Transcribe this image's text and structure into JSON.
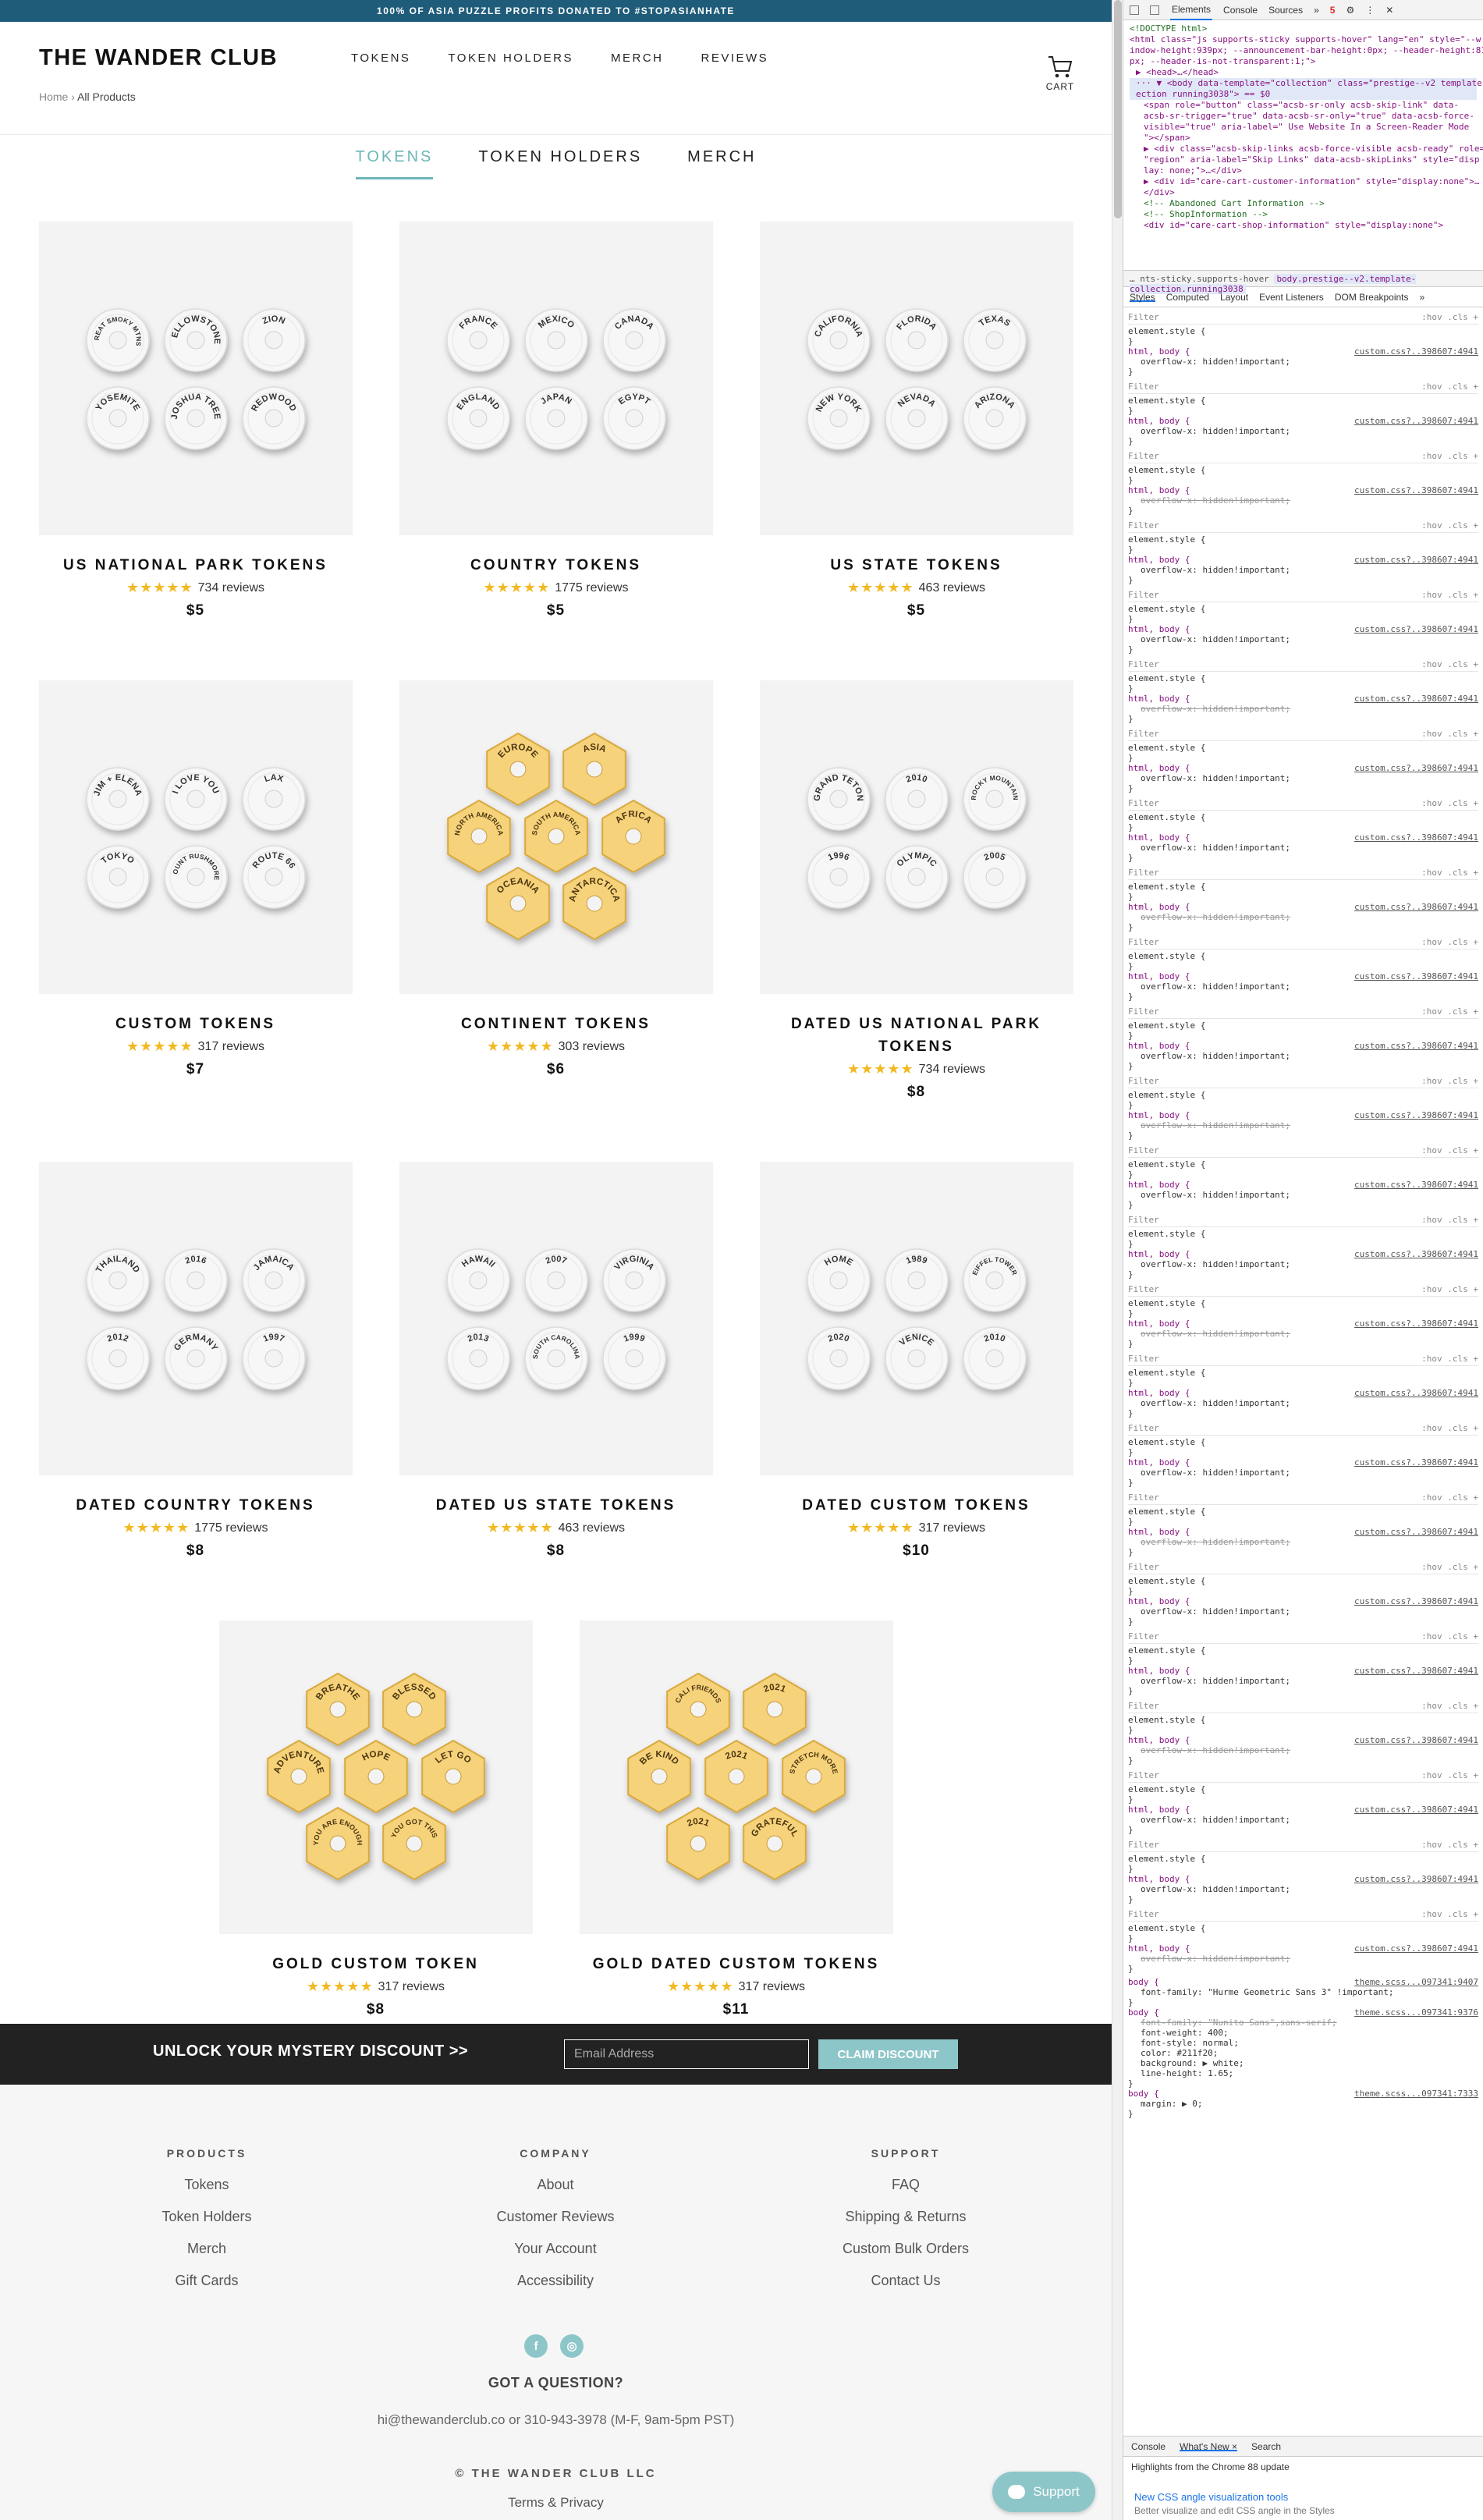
{
  "announcement": "100% OF ASIA PUZZLE PROFITS DONATED TO #STOPASIANHATE",
  "logo": "THE WANDER CLUB",
  "main_nav": [
    "TOKENS",
    "TOKEN HOLDERS",
    "MERCH",
    "REVIEWS"
  ],
  "cart_label": "CART",
  "breadcrumb": {
    "home": "Home",
    "separator": "›",
    "current": "All Products"
  },
  "collection_tabs": [
    {
      "label": "TOKENS",
      "active": true
    },
    {
      "label": "TOKEN HOLDERS",
      "active": false
    },
    {
      "label": "MERCH",
      "active": false
    }
  ],
  "products": [
    {
      "title": "US NATIONAL PARK TOKENS",
      "stars": "★★★★★",
      "reviews": "734 reviews",
      "price": "$5",
      "token_style": "silver",
      "token_labels": [
        "GREAT SMOKY MTNS",
        "YELLOWSTONE",
        "ZION",
        "YOSEMITE",
        "JOSHUA TREE",
        "REDWOOD"
      ]
    },
    {
      "title": "COUNTRY TOKENS",
      "stars": "★★★★★",
      "reviews": "1775 reviews",
      "price": "$5",
      "token_style": "silver",
      "token_labels": [
        "FRANCE",
        "MEXICO",
        "CANADA",
        "ENGLAND",
        "JAPAN",
        "EGYPT"
      ]
    },
    {
      "title": "US STATE TOKENS",
      "stars": "★★★★★",
      "reviews": "463 reviews",
      "price": "$5",
      "token_style": "silver",
      "token_labels": [
        "CALIFORNIA",
        "FLORIDA",
        "TEXAS",
        "NEW YORK",
        "NEVADA",
        "ARIZONA"
      ]
    },
    {
      "title": "CUSTOM TOKENS",
      "stars": "★★★★★",
      "reviews": "317 reviews",
      "price": "$7",
      "token_style": "silver",
      "token_labels": [
        "JIM + ELENA",
        "I LOVE YOU",
        "LAX",
        "TOKYO",
        "MOUNT RUSHMORE",
        "ROUTE 66"
      ]
    },
    {
      "title": "CONTINENT TOKENS",
      "stars": "★★★★★",
      "reviews": "303 reviews",
      "price": "$6",
      "token_style": "gold",
      "token_labels": [
        "EUROPE",
        "ASIA",
        "NORTH AMERICA",
        "SOUTH AMERICA",
        "AFRICA",
        "OCEANIA",
        "ANTARCTICA"
      ]
    },
    {
      "title": "DATED US NATIONAL PARK TOKENS",
      "stars": "★★★★★",
      "reviews": "734 reviews",
      "price": "$8",
      "token_style": "silver",
      "token_labels": [
        "GRAND TETON",
        "2010",
        "ROCKY MOUNTAIN",
        "1996",
        "OLYMPIC",
        "2005"
      ]
    },
    {
      "title": "DATED COUNTRY TOKENS",
      "stars": "★★★★★",
      "reviews": "1775 reviews",
      "price": "$8",
      "token_style": "silver",
      "token_labels": [
        "THAILAND",
        "2016",
        "JAMAICA",
        "2012",
        "GERMANY",
        "1997"
      ]
    },
    {
      "title": "DATED US STATE TOKENS",
      "stars": "★★★★★",
      "reviews": "463 reviews",
      "price": "$8",
      "token_style": "silver",
      "token_labels": [
        "HAWAII",
        "2007",
        "VIRGINIA",
        "2013",
        "SOUTH CAROLINA",
        "1999"
      ]
    },
    {
      "title": "DATED CUSTOM TOKENS",
      "stars": "★★★★★",
      "reviews": "317 reviews",
      "price": "$10",
      "token_style": "silver",
      "token_labels": [
        "HOME",
        "1989",
        "EIFFEL TOWER",
        "2020",
        "VENICE",
        "2010"
      ]
    },
    {
      "title": "GOLD CUSTOM TOKEN",
      "stars": "★★★★★",
      "reviews": "317 reviews",
      "price": "$8",
      "token_style": "gold",
      "token_labels": [
        "BREATHE",
        "BLESSED",
        "ADVENTURE",
        "HOPE",
        "LET GO",
        "YOU ARE ENOUGH",
        "YOU GOT THIS"
      ]
    },
    {
      "title": "GOLD DATED CUSTOM TOKENS",
      "stars": "★★★★★",
      "reviews": "317 reviews",
      "price": "$11",
      "token_style": "gold",
      "token_labels": [
        "CALI FRIENDS",
        "2021",
        "BE KIND",
        "2021",
        "STRETCH MORE",
        "2021",
        "GRATEFUL"
      ]
    }
  ],
  "newsletter": {
    "text": "UNLOCK YOUR MYSTERY DISCOUNT >>",
    "placeholder": "Email Address",
    "button": "CLAIM DISCOUNT"
  },
  "footer": {
    "columns": [
      {
        "heading": "PRODUCTS",
        "items": [
          "Tokens",
          "Token Holders",
          "Merch",
          "Gift Cards"
        ]
      },
      {
        "heading": "COMPANY",
        "items": [
          "About",
          "Customer Reviews",
          "Your Account",
          "Accessibility"
        ]
      },
      {
        "heading": "SUPPORT",
        "items": [
          "FAQ",
          "Shipping & Returns",
          "Custom Bulk Orders",
          "Contact Us"
        ]
      }
    ],
    "social": [
      {
        "icon": "facebook-icon",
        "glyph": "f"
      },
      {
        "icon": "instagram-icon",
        "glyph": "◎"
      }
    ],
    "question": "GOT A QUESTION?",
    "contact": "hi@thewanderclub.co or 310-943-3978 (M-F, 9am-5pm PST)",
    "copyright": "© THE WANDER CLUB LLC",
    "terms": "Terms & Privacy"
  },
  "support_button": "Support",
  "colors": {
    "accent": "#6cb6b8",
    "announcement_bg": "#1f5c7a",
    "star": "#f2b922",
    "newsletter_bg": "#222222",
    "button": "#8dc6c9"
  },
  "devtools": {
    "tabs": [
      "Elements",
      "Console",
      "Sources",
      "»"
    ],
    "error_count": "5",
    "dom_lines": [
      "<!DOCTYPE html>",
      "<html class=\"js supports-sticky supports-hover\" lang=\"en\" style=\"--w",
      "indow-height:939px; --announcement-bar-height:0px; --header-height:81",
      "px; --header-is-not-transparent:1;\">",
      "▶ <head>…</head>",
      "··· ▼ <body data-template=\"collection\" class=\"prestige--v2 template-coll",
      "ection running3038\"> == $0",
      "<span role=\"button\" class=\"acsb-sr-only acsb-skip-link\" data-",
      "acsb-sr-trigger=\"true\" data-acsb-sr-only=\"true\" data-acsb-force-",
      "visible=\"true\" aria-label=\" Use Website In a Screen-Reader Mode",
      "\"></span>",
      "▶ <div class=\"acsb-skip-links acsb-force-visible acsb-ready\" role=",
      "\"region\" aria-label=\"Skip Links\" data-acsb-skipLinks\" style=\"disp",
      "lay: none;\">…</div>",
      "▶ <div id=\"care-cart-customer-information\" style=\"display:none\">…",
      "</div>",
      "<!-- Abandoned Cart Information -->",
      "<!-- ShopInformation -->",
      "<div id=\"care-cart-shop-information\" style=\"display:none\">"
    ],
    "crumbs": [
      "… nts-sticky.supports-hover",
      "body.prestige--v2.template-collection.running3038"
    ],
    "panel_tabs": [
      "Styles",
      "Computed",
      "Layout",
      "Event Listeners",
      "DOM Breakpoints",
      "»"
    ],
    "filter_placeholder": "Filter",
    "filter_tools": ":hov .cls +",
    "element_style": "element.style {",
    "close_brace": "}",
    "rule_selector": "html, body {",
    "rule_prop": "overflow-x: hidden!important;",
    "rule_source": "custom.css?..398607:4941",
    "body_rule": {
      "selector": "body {",
      "source": "theme.scss...097341:9407",
      "lines": [
        "font-family: \"Hurme Geometric Sans 3\" !important;"
      ],
      "selector2": "body {",
      "source2": "theme.scss...097341:9376",
      "lines2": [
        "font-family: \"Nunito Sans\",sans-serif;",
        "font-weight: 400;",
        "font-style: normal;",
        "color: #211f20;",
        "background: ▶ white;",
        "line-height: 1.65;"
      ],
      "selector3": "body {",
      "source3": "theme.scss...097341:7333",
      "lines3": [
        "margin: ▶ 0;"
      ]
    },
    "bottom_tabs": [
      "Console",
      "What's New ×",
      "Search"
    ],
    "highlights": "Highlights from the Chrome 88 update",
    "news_title": "New CSS angle visualization tools",
    "news_desc": "Better visualize and edit CSS angle in the Styles"
  }
}
